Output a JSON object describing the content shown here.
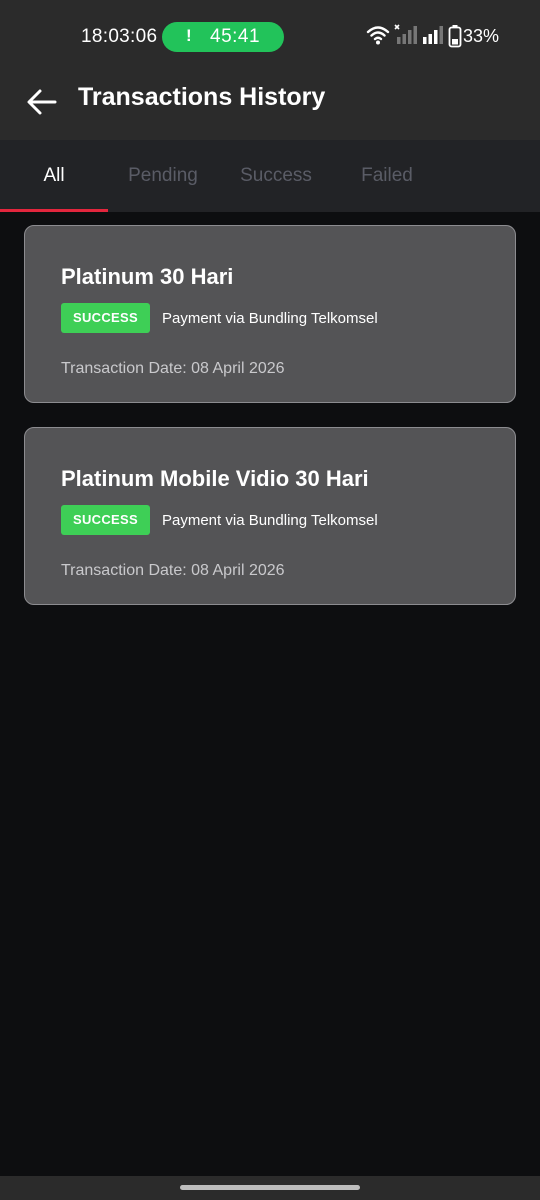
{
  "status_bar": {
    "time": "18:03:06",
    "call_timer": "45:41",
    "call_alert_symbol": "!",
    "battery_percent": "33%",
    "icons": [
      "wifi-icon",
      "signal-no-service-icon",
      "signal-icon",
      "battery-icon"
    ]
  },
  "header": {
    "back_icon": "arrow-left-icon",
    "title": "Transactions History"
  },
  "tabs": [
    {
      "label": "All",
      "active": true
    },
    {
      "label": "Pending",
      "active": false
    },
    {
      "label": "Success",
      "active": false
    },
    {
      "label": "Failed",
      "active": false
    }
  ],
  "transactions": [
    {
      "title": "Platinum 30 Hari",
      "status": "SUCCESS",
      "payment": "Payment via Bundling Telkomsel",
      "date": "Transaction Date: 08 April 2026"
    },
    {
      "title": "Platinum Mobile Vidio 30 Hari",
      "status": "SUCCESS",
      "payment": "Payment via Bundling Telkomsel",
      "date": "Transaction Date: 08 April 2026"
    }
  ],
  "colors": {
    "accent": "#e3263d",
    "success": "#3ecf56",
    "call_pill": "#22c35a",
    "card_bg": "#545456",
    "background": "#0d0e10"
  }
}
